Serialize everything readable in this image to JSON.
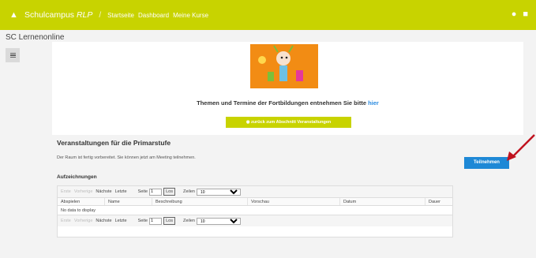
{
  "topbar": {
    "brand_prefix": "Schulcampus ",
    "brand_suffix": "RLP",
    "nav": [
      "Startseite",
      "Dashboard",
      "Meine Kurse"
    ]
  },
  "page": {
    "title": "SC Lernenonline"
  },
  "banner": {
    "text": "Themen und Termine der Fortbildungen entnehmen Sie bitte ",
    "link": "hier",
    "back_button": "zurück zum Abschnitt Veranstaltungen"
  },
  "section": {
    "title": "Veranstaltungen für die Primarstufe",
    "ready": "Der Raum ist fertig vorbereitet. Sie können jetzt am Meeting teilnehmen.",
    "join": "Teilnehmen"
  },
  "recordings": {
    "title": "Aufzeichnungen",
    "pager": {
      "first": "Erste",
      "prev": "Vorherige",
      "next": "Nächste",
      "last": "Letzte",
      "page_label": "Seite",
      "page_value": "1",
      "go": "Los",
      "rows_label": "Zeilen",
      "rows_value": "10"
    },
    "columns": [
      "Abspielen",
      "Name",
      "Beschreibung",
      "Vorschau",
      "Datum",
      "Dauer"
    ],
    "empty": "No data to display"
  },
  "colors": {
    "accent": "#c8d300",
    "primary": "#1e88d6"
  }
}
